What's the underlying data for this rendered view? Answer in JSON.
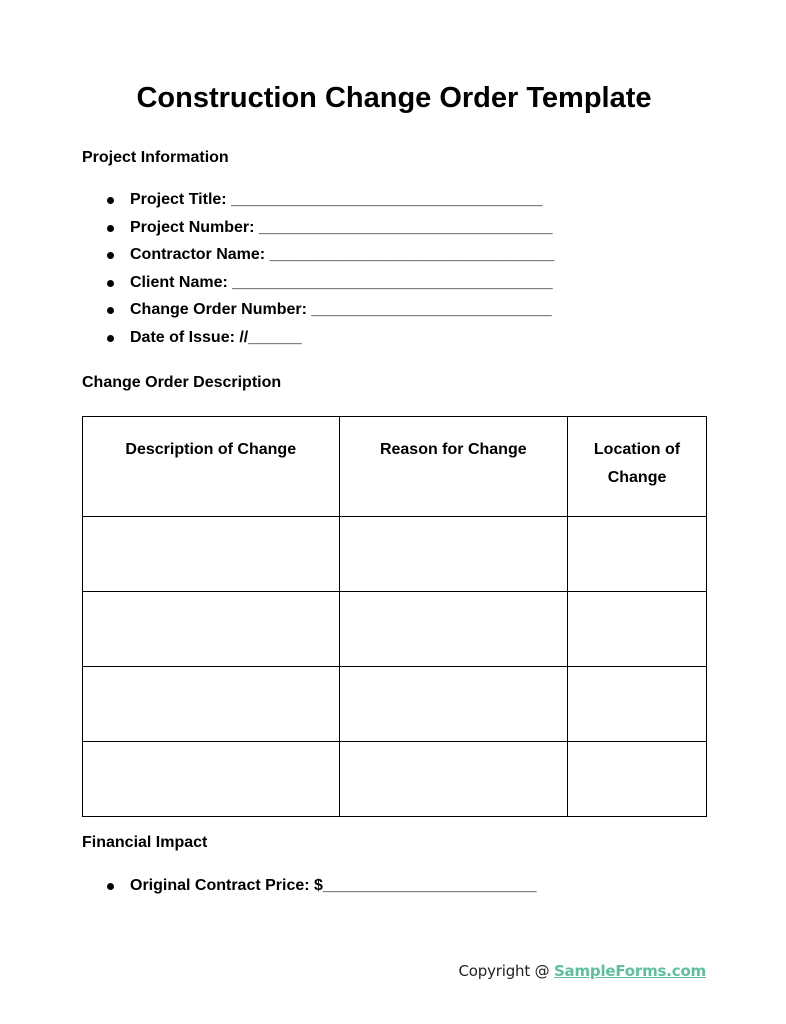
{
  "document": {
    "title": "Construction Change Order Template",
    "sections": {
      "project_info": {
        "heading": "Project Information",
        "fields": [
          {
            "label": "Project Title: ",
            "blank": "___________________________________"
          },
          {
            "label": "Project Number: ",
            "blank": "_________________________________"
          },
          {
            "label": "Contractor Name: ",
            "blank": "________________________________"
          },
          {
            "label": "Client Name: ",
            "blank": "____________________________________"
          },
          {
            "label": "Change Order Number: ",
            "blank": "___________________________"
          },
          {
            "label": "Date of Issue: ",
            "blank": "//______"
          }
        ]
      },
      "description": {
        "heading": "Change Order Description",
        "table": {
          "headers": [
            "Description of Change",
            "Reason for Change",
            "Location of Change"
          ],
          "rows": [
            [
              "",
              "",
              ""
            ],
            [
              "",
              "",
              ""
            ],
            [
              "",
              "",
              ""
            ],
            [
              "",
              "",
              ""
            ]
          ]
        }
      },
      "financial": {
        "heading": "Financial Impact",
        "fields": [
          {
            "label": "Original Contract Price: ",
            "blank": "$________________________"
          }
        ]
      }
    }
  },
  "footer": {
    "copyright_text": "Copyright @ ",
    "link_text": "SampleForms.com",
    "link_color": "#5ec09a"
  }
}
